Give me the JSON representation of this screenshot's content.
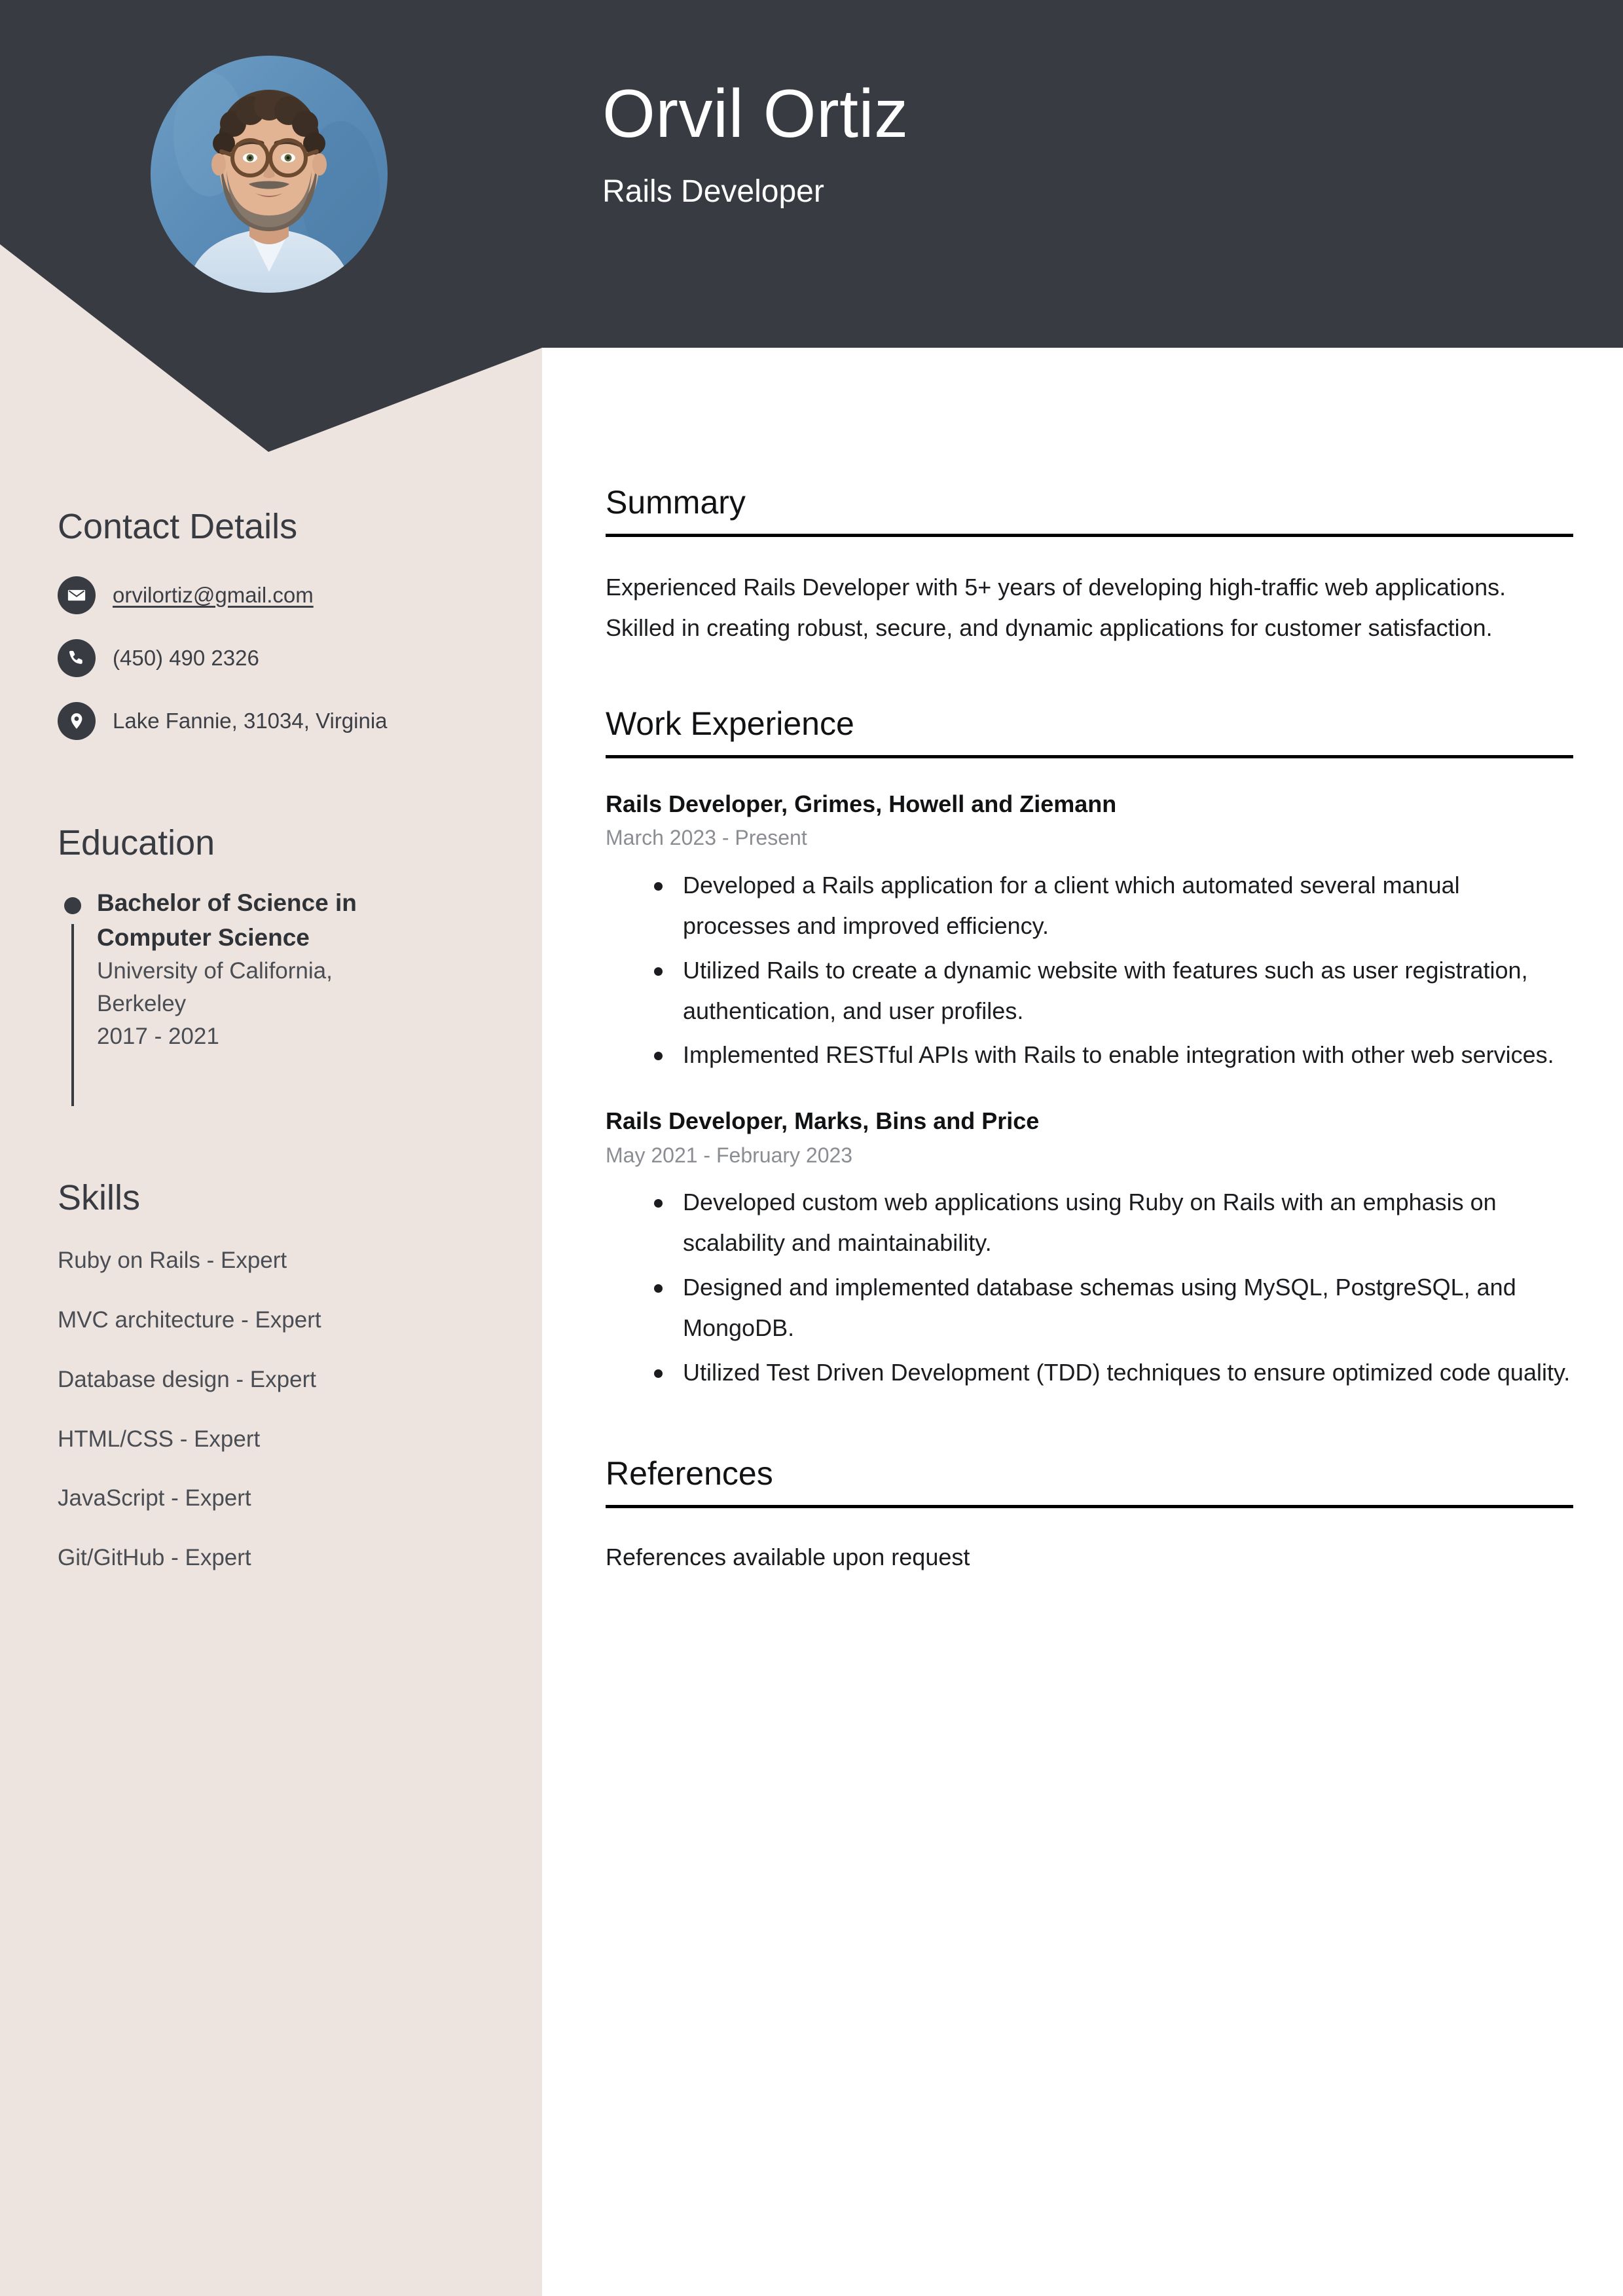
{
  "colors": {
    "header_bg": "#383B41",
    "sidebar_bg": "#EDE4DF",
    "main_bg": "#FFFFFF",
    "accent_text": "#1A1C1F",
    "muted_text": "#8A8D92"
  },
  "header": {
    "name": "Orvil Ortiz",
    "job_title": "Rails Developer",
    "avatar_alt": "profile-photo"
  },
  "sidebar": {
    "contact": {
      "heading": "Contact Details",
      "items": [
        {
          "icon": "envelope-icon",
          "value": "orvilortiz@gmail.com",
          "is_link": true
        },
        {
          "icon": "phone-icon",
          "value": "(450) 490 2326",
          "is_link": false
        },
        {
          "icon": "location-pin-icon",
          "value": "Lake Fannie, 31034, Virginia",
          "is_link": false
        }
      ]
    },
    "education": {
      "heading": "Education",
      "items": [
        {
          "degree": "Bachelor of Science in Computer Science",
          "school": "University of California, Berkeley",
          "dates": "2017 - 2021"
        }
      ]
    },
    "skills": {
      "heading": "Skills",
      "items": [
        "Ruby on Rails - Expert",
        "MVC architecture - Expert",
        "Database design - Expert",
        "HTML/CSS - Expert",
        "JavaScript - Expert",
        "Git/GitHub - Expert"
      ]
    }
  },
  "main": {
    "summary": {
      "heading": "Summary",
      "text": "Experienced Rails Developer with 5+ years of developing high-traffic web applications. Skilled in creating robust, secure, and dynamic applications for customer satisfaction."
    },
    "work_experience": {
      "heading": "Work Experience",
      "jobs": [
        {
          "title": "Rails Developer, Grimes, Howell and Ziemann",
          "dates": "March 2023 - Present",
          "bullets": [
            "Developed a Rails application for a client which automated several manual processes and improved efficiency.",
            "Utilized Rails to create a dynamic website with features such as user registration, authentication, and user profiles.",
            "Implemented RESTful APIs with Rails to enable integration with other web services."
          ]
        },
        {
          "title": "Rails Developer, Marks, Bins and Price",
          "dates": "May 2021 - February 2023",
          "bullets": [
            "Developed custom web applications using Ruby on Rails with an emphasis on scalability and maintainability.",
            "Designed and implemented database schemas using MySQL, PostgreSQL, and MongoDB.",
            "Utilized Test Driven Development (TDD) techniques to ensure optimized code quality."
          ]
        }
      ]
    },
    "references": {
      "heading": "References",
      "text": "References available upon request"
    }
  }
}
